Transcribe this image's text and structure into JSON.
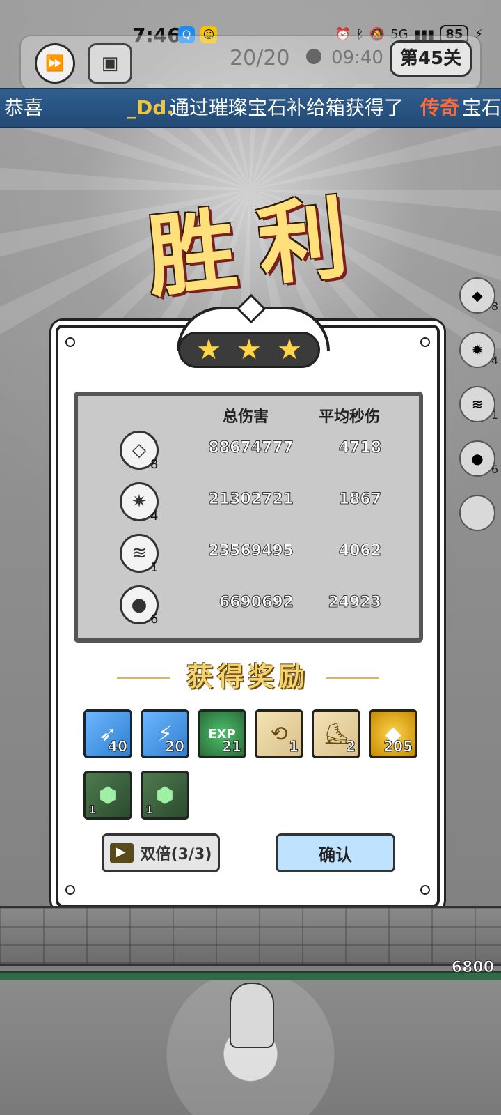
{
  "status_bar": {
    "time": "7:46",
    "battery": "85",
    "network": "5G"
  },
  "hud": {
    "wave": "20/20",
    "timer": "09:40",
    "level": "第45关"
  },
  "marquee": {
    "congrats": "恭喜",
    "player": "_Dd.",
    "message": "通过璀璨宝石补给箱获得了",
    "rarity": "传奇",
    "item": "宝石"
  },
  "title": "胜利",
  "side_towers": [
    {
      "level": "8"
    },
    {
      "level": "4"
    },
    {
      "level": "1"
    },
    {
      "level": "6"
    }
  ],
  "stats": {
    "headers": {
      "total_damage": "总伤害",
      "avg_dps": "平均秒伤"
    },
    "rows": [
      {
        "icon": "crystal-shard-icon",
        "level": "8",
        "total": "88674777",
        "dps": "4718"
      },
      {
        "icon": "ice-crystal-icon",
        "level": "4",
        "total": "21302721",
        "dps": "1867"
      },
      {
        "icon": "tornado-icon",
        "level": "1",
        "total": "23569495",
        "dps": "4062"
      },
      {
        "icon": "bomb-icon",
        "level": "6",
        "total": "6690692",
        "dps": "24923"
      }
    ]
  },
  "rewards_title": "获得奖励",
  "rewards": [
    {
      "type": "blue",
      "icon": "blue-card-icon",
      "count": "40"
    },
    {
      "type": "blue",
      "icon": "blue-lightning-card-icon",
      "count": "20"
    },
    {
      "type": "green",
      "icon": "exp-orb-icon",
      "count": "21",
      "label": "EXP"
    },
    {
      "type": "scroll",
      "icon": "scroll-icon",
      "count": "1"
    },
    {
      "type": "scroll",
      "icon": "boot-scroll-icon",
      "count": "2"
    },
    {
      "type": "gold",
      "icon": "gold-coin-icon",
      "count": "205"
    },
    {
      "type": "emerald",
      "icon": "emerald-gem-icon",
      "count": "1"
    },
    {
      "type": "emerald",
      "icon": "emerald-gem-icon",
      "count": "1"
    }
  ],
  "buttons": {
    "double": "双倍(3/3)",
    "confirm": "确认"
  },
  "base_hp": "6800"
}
